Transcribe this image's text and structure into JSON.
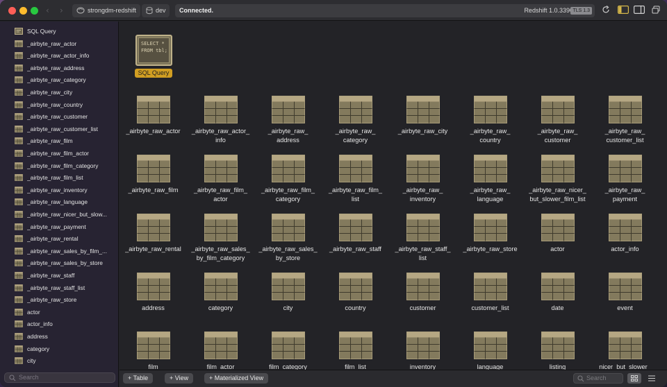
{
  "titlebar": {
    "connection_name": "strongdm-redshift",
    "database_name": "dev",
    "status": "Connected.",
    "server_version": "Redshift 1.0.33904",
    "tls_badge": "TLS 1.3"
  },
  "sidebar": {
    "items": [
      {
        "label": "SQL Query",
        "icon": "sql-query-icon"
      },
      {
        "label": "_airbyte_raw_actor",
        "icon": "table-icon"
      },
      {
        "label": "_airbyte_raw_actor_info",
        "icon": "table-icon"
      },
      {
        "label": "_airbyte_raw_address",
        "icon": "table-icon"
      },
      {
        "label": "_airbyte_raw_category",
        "icon": "table-icon"
      },
      {
        "label": "_airbyte_raw_city",
        "icon": "table-icon"
      },
      {
        "label": "_airbyte_raw_country",
        "icon": "table-icon"
      },
      {
        "label": "_airbyte_raw_customer",
        "icon": "table-icon"
      },
      {
        "label": "_airbyte_raw_customer_list",
        "icon": "table-icon"
      },
      {
        "label": "_airbyte_raw_film",
        "icon": "table-icon"
      },
      {
        "label": "_airbyte_raw_film_actor",
        "icon": "table-icon"
      },
      {
        "label": "_airbyte_raw_film_category",
        "icon": "table-icon"
      },
      {
        "label": "_airbyte_raw_film_list",
        "icon": "table-icon"
      },
      {
        "label": "_airbyte_raw_inventory",
        "icon": "table-icon"
      },
      {
        "label": "_airbyte_raw_language",
        "icon": "table-icon"
      },
      {
        "label": "_airbyte_raw_nicer_but_slow...",
        "icon": "table-icon"
      },
      {
        "label": "_airbyte_raw_payment",
        "icon": "table-icon"
      },
      {
        "label": "_airbyte_raw_rental",
        "icon": "table-icon"
      },
      {
        "label": "_airbyte_raw_sales_by_film_...",
        "icon": "table-icon"
      },
      {
        "label": "_airbyte_raw_sales_by_store",
        "icon": "table-icon"
      },
      {
        "label": "_airbyte_raw_staff",
        "icon": "table-icon"
      },
      {
        "label": "_airbyte_raw_staff_list",
        "icon": "table-icon"
      },
      {
        "label": "_airbyte_raw_store",
        "icon": "table-icon"
      },
      {
        "label": "actor",
        "icon": "table-icon"
      },
      {
        "label": "actor_info",
        "icon": "table-icon"
      },
      {
        "label": "address",
        "icon": "table-icon"
      },
      {
        "label": "category",
        "icon": "table-icon"
      },
      {
        "label": "city",
        "icon": "table-icon"
      }
    ],
    "search_placeholder": "Search"
  },
  "main": {
    "sql_query_tile": {
      "preview": "SELECT *\nFROM tbl;",
      "label": "SQL Query"
    },
    "tables": [
      [
        "_airbyte_raw_actor"
      ],
      [
        "_airbyte_raw_actor_",
        "info"
      ],
      [
        "_airbyte_raw_",
        "address"
      ],
      [
        "_airbyte_raw_",
        "category"
      ],
      [
        "_airbyte_raw_city"
      ],
      [
        "_airbyte_raw_",
        "country"
      ],
      [
        "_airbyte_raw_",
        "customer"
      ],
      [
        "_airbyte_raw_",
        "customer_list"
      ],
      [
        "_airbyte_raw_film"
      ],
      [
        "_airbyte_raw_film_",
        "actor"
      ],
      [
        "_airbyte_raw_film_",
        "category"
      ],
      [
        "_airbyte_raw_film_",
        "list"
      ],
      [
        "_airbyte_raw_",
        "inventory"
      ],
      [
        "_airbyte_raw_",
        "language"
      ],
      [
        "_airbyte_raw_nicer_",
        "but_slower_film_list"
      ],
      [
        "_airbyte_raw_",
        "payment"
      ],
      [
        "_airbyte_raw_rental"
      ],
      [
        "_airbyte_raw_sales_",
        "by_film_category"
      ],
      [
        "_airbyte_raw_sales_",
        "by_store"
      ],
      [
        "_airbyte_raw_staff"
      ],
      [
        "_airbyte_raw_staff_",
        "list"
      ],
      [
        "_airbyte_raw_store"
      ],
      [
        "actor"
      ],
      [
        "actor_info"
      ],
      [
        "address"
      ],
      [
        "category"
      ],
      [
        "city"
      ],
      [
        "country"
      ],
      [
        "customer"
      ],
      [
        "customer_list"
      ],
      [
        "date"
      ],
      [
        "event"
      ],
      [
        "film"
      ],
      [
        "film_actor"
      ],
      [
        "film_category"
      ],
      [
        "film_list"
      ],
      [
        "inventory"
      ],
      [
        "language"
      ],
      [
        "listing"
      ],
      [
        "nicer_but_slower_"
      ]
    ]
  },
  "bottombar": {
    "add_table": "+ Table",
    "add_view": "+ View",
    "add_materialized_view": "+ Materialized View",
    "search_placeholder": "Search",
    "view_modes": [
      "grid-view-icon",
      "list-view-icon"
    ]
  },
  "colors": {
    "accent": "#d19e22",
    "table_icon_fill": "#837a5d",
    "table_icon_header": "#b5a783"
  }
}
